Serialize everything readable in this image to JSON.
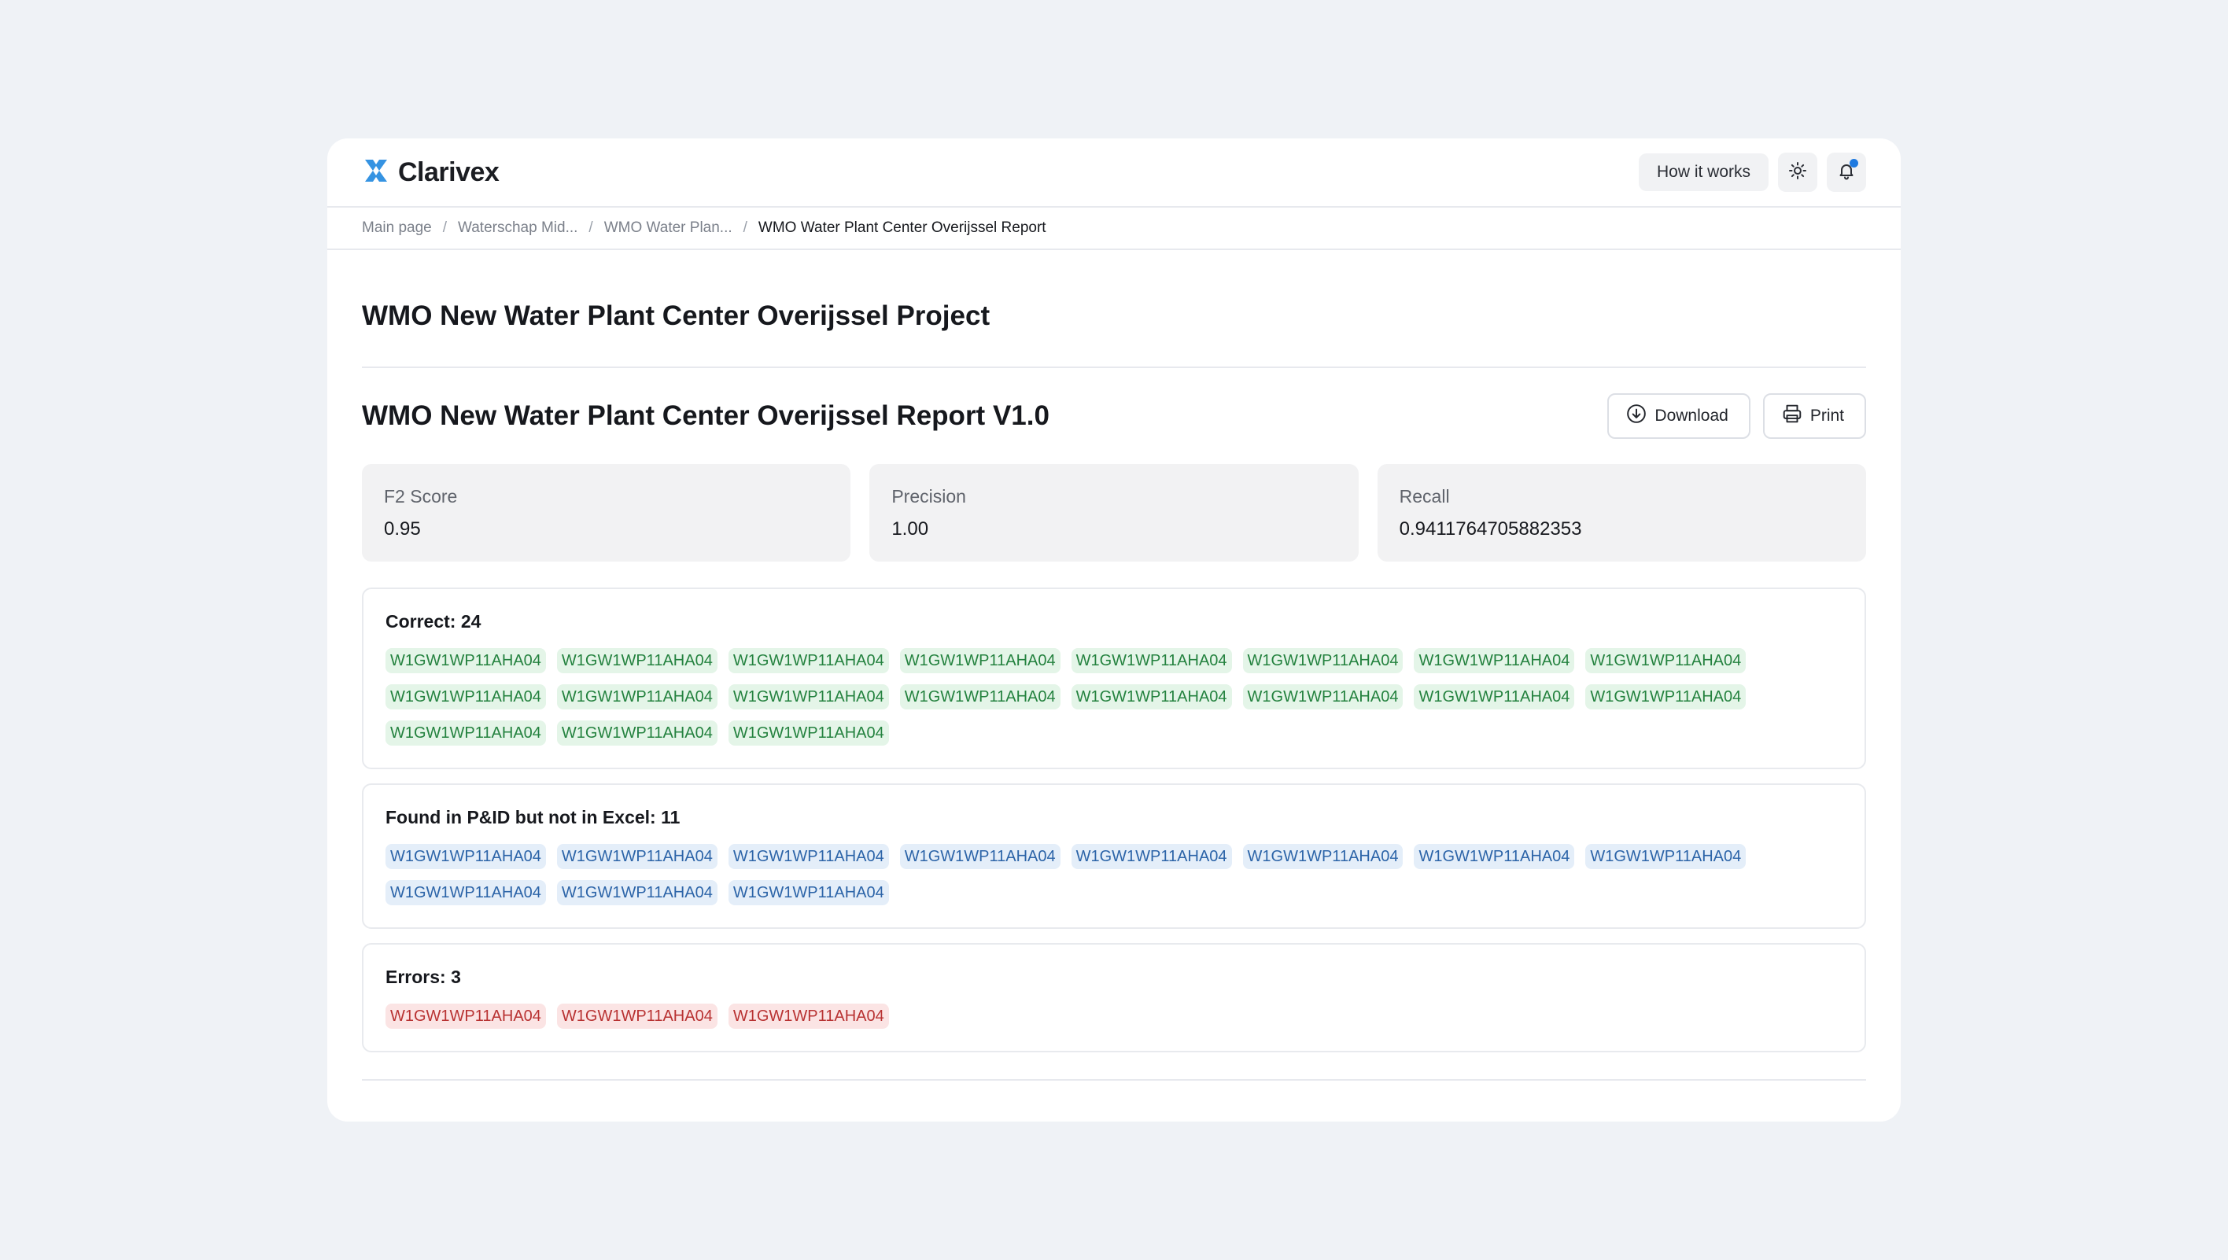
{
  "app": {
    "brand": "Clarivex",
    "how_it_works": "How it works",
    "accent_color": "#2a8de0"
  },
  "breadcrumb": [
    "Main page",
    "Waterschap Mid...",
    "WMO Water Plan...",
    "WMO Water Plant Center Overijssel Report"
  ],
  "project": {
    "title": "WMO New Water Plant Center Overijssel Project"
  },
  "report": {
    "title": "WMO New Water Plant Center Overijssel Report V1.0",
    "download_label": "Download",
    "print_label": "Print"
  },
  "metrics": [
    {
      "label": "F2 Score",
      "value": "0.95"
    },
    {
      "label": "Precision",
      "value": "1.00"
    },
    {
      "label": "Recall",
      "value": "0.9411764705882353"
    }
  ],
  "sections": [
    {
      "title": "Correct: 24",
      "color": "green",
      "tags": [
        "W1GW1WP11AHA04",
        "W1GW1WP11AHA04",
        "W1GW1WP11AHA04",
        "W1GW1WP11AHA04",
        "W1GW1WP11AHA04",
        "W1GW1WP11AHA04",
        "W1GW1WP11AHA04",
        "W1GW1WP11AHA04",
        "W1GW1WP11AHA04",
        "W1GW1WP11AHA04",
        "W1GW1WP11AHA04",
        "W1GW1WP11AHA04",
        "W1GW1WP11AHA04",
        "W1GW1WP11AHA04",
        "W1GW1WP11AHA04",
        "W1GW1WP11AHA04",
        "W1GW1WP11AHA04",
        "W1GW1WP11AHA04",
        "W1GW1WP11AHA04"
      ]
    },
    {
      "title": "Found in P&ID but not in Excel: 11",
      "color": "blue",
      "tags": [
        "W1GW1WP11AHA04",
        "W1GW1WP11AHA04",
        "W1GW1WP11AHA04",
        "W1GW1WP11AHA04",
        "W1GW1WP11AHA04",
        "W1GW1WP11AHA04",
        "W1GW1WP11AHA04",
        "W1GW1WP11AHA04",
        "W1GW1WP11AHA04",
        "W1GW1WP11AHA04",
        "W1GW1WP11AHA04"
      ]
    },
    {
      "title": "Errors: 3",
      "color": "red",
      "tags": [
        "W1GW1WP11AHA04",
        "W1GW1WP11AHA04",
        "W1GW1WP11AHA04"
      ]
    }
  ]
}
